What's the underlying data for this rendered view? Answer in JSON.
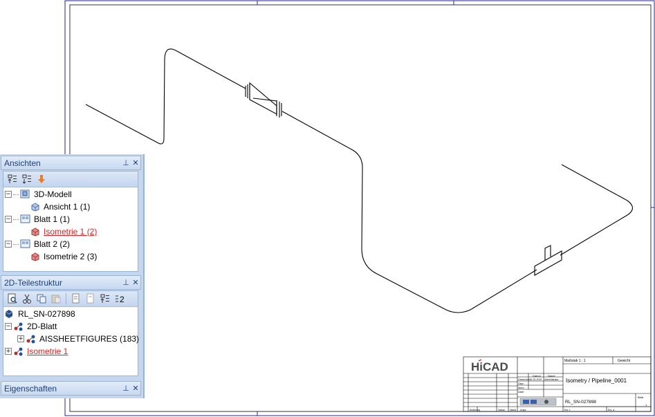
{
  "panels": {
    "views": {
      "title": "Ansichten",
      "tree": [
        {
          "label": "3D-Modell",
          "level": 0,
          "expander": "minus"
        },
        {
          "label": "Ansicht 1 (1)",
          "level": 1
        },
        {
          "label": "Blatt 1 (1)",
          "level": 0,
          "expander": "minus"
        },
        {
          "label": "Isometrie 1 (2)",
          "level": 1,
          "highlight": true
        },
        {
          "label": "Blatt 2 (2)",
          "level": 0,
          "expander": "minus"
        },
        {
          "label": "Isometrie 2 (3)",
          "level": 1
        }
      ]
    },
    "parts": {
      "title": "2D-Teilestruktur",
      "tree": [
        {
          "label": "RL_SN-027898",
          "level": 0
        },
        {
          "label": "2D-Blatt",
          "level": 0,
          "expander": "minus"
        },
        {
          "label": "AISSHEETFIGURES (183)",
          "level": 1,
          "expander": "plus"
        },
        {
          "label": "Isometrie 1",
          "level": 0,
          "expander": "plus",
          "highlight": true
        }
      ]
    },
    "properties": {
      "title": "Eigenschaften"
    }
  },
  "title_block": {
    "logo": "HiCAD",
    "scale_label": "Maßstab 1 : 1",
    "weight_label": "Gewicht",
    "drawing_title": "Isometry / Pipeline_0001",
    "drawing_number": "RL_SN-027898",
    "sheet_label": "Blatt",
    "sheet_number": "1",
    "sheets_total_label": "Bl.",
    "datum_label": "Datum",
    "name_label": "Name",
    "gezeichnet_label": "Gezeichnet",
    "gezeichnet_date": "11.02.2019",
    "gezeichnet_name": "Administrator",
    "gepr_label": "Gepr.",
    "norm_label": "Norm",
    "file_label": "Datei",
    "aenderung_label": "Änderung",
    "datum2_label": "Datum",
    "name2_label": "Name",
    "urspr_label": "Urspr.",
    "ers_label": "Ers. f.",
    "ers_d_label": "Ers. d."
  },
  "colors": {
    "border": "#1f1fa8",
    "panel_header_text": "#1b3f78",
    "highlight_red": "#e02020"
  }
}
